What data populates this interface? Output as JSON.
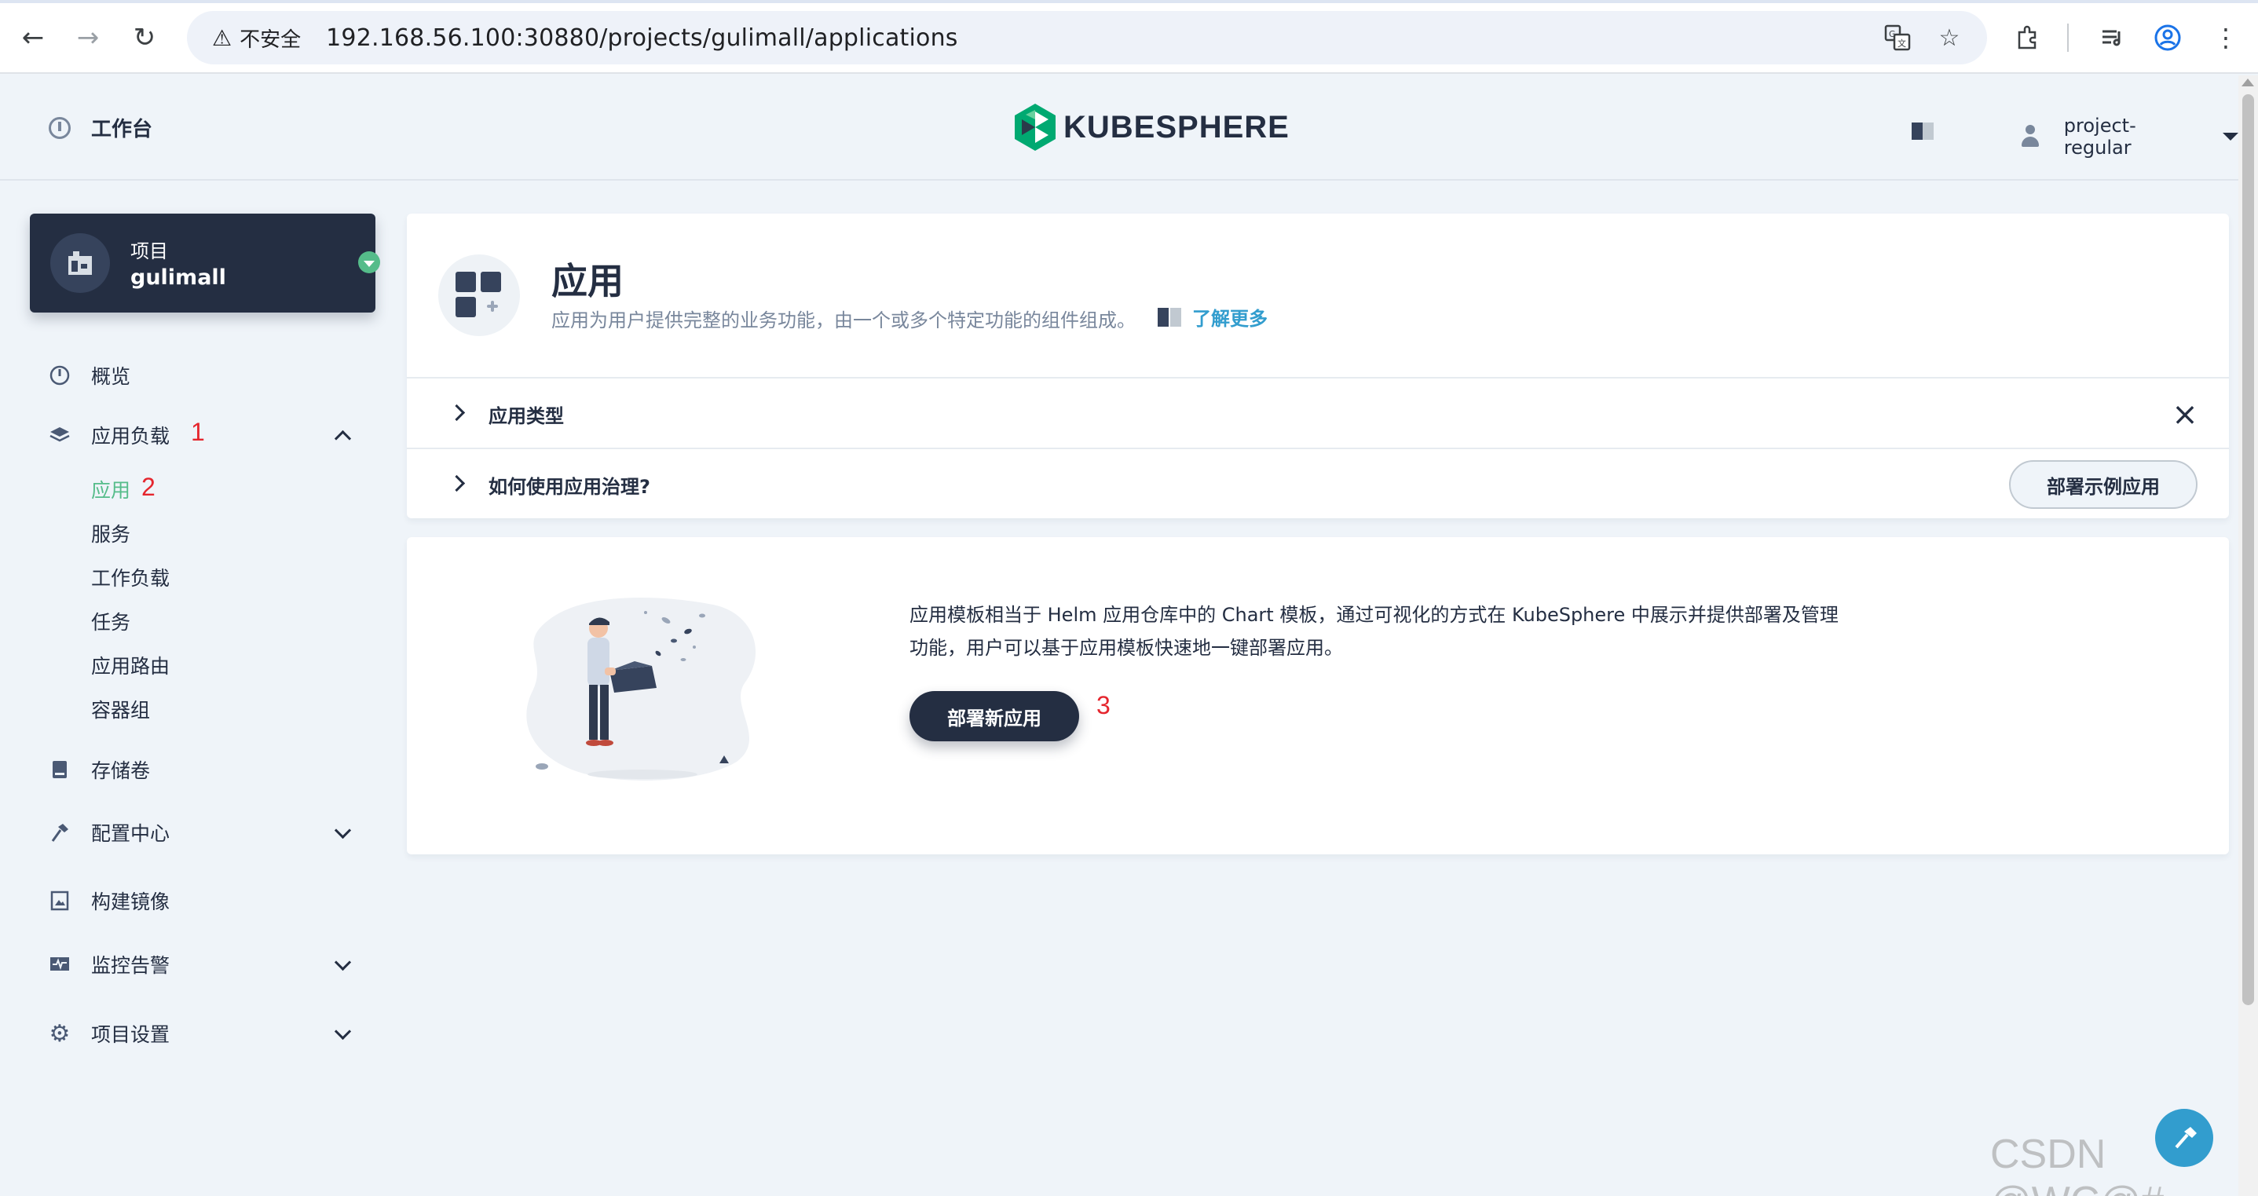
{
  "browser": {
    "security_label": "不安全",
    "url": "192.168.56.100:30880/projects/gulimall/applications"
  },
  "header": {
    "workbench": "工作台",
    "logo_text": "KUBESPHERE",
    "user_name": "project-regular"
  },
  "sidebar": {
    "project_label": "项目",
    "project_name": "gulimall",
    "items": [
      {
        "label": "概览",
        "icon": "dashboard-icon"
      },
      {
        "label": "应用负载",
        "icon": "layers-icon",
        "expanded": true,
        "children": [
          "应用",
          "服务",
          "工作负载",
          "任务",
          "应用路由",
          "容器组"
        ]
      },
      {
        "label": "存储卷",
        "icon": "hard-disk-icon"
      },
      {
        "label": "配置中心",
        "icon": "hammer-icon",
        "expanded": false
      },
      {
        "label": "构建镜像",
        "icon": "image-icon"
      },
      {
        "label": "监控告警",
        "icon": "monitor-icon",
        "expanded": false
      },
      {
        "label": "项目设置",
        "icon": "gear-icon",
        "expanded": false
      }
    ],
    "active_child": "应用"
  },
  "annotations": [
    "1",
    "2",
    "3"
  ],
  "banner": {
    "title": "应用",
    "description": "应用为用户提供完整的业务功能，由一个或多个特定功能的组件组成。",
    "learn_more": "了解更多"
  },
  "tips": [
    {
      "label": "应用类型"
    },
    {
      "label": "如何使用应用治理?",
      "action": "部署示例应用"
    }
  ],
  "empty_state": {
    "text": "应用模板相当于 Helm 应用仓库中的 Chart 模板，通过可视化的方式在 KubeSphere 中展示并提供部署及管理功能，用户可以基于应用模板快速地一键部署应用。",
    "button": "部署新应用"
  },
  "watermark": "CSDN @WC@#",
  "colors": {
    "dark": "#242e42",
    "accent_green": "#55bc8a",
    "link_blue": "#329dce",
    "annotation_red": "#e5262e"
  }
}
